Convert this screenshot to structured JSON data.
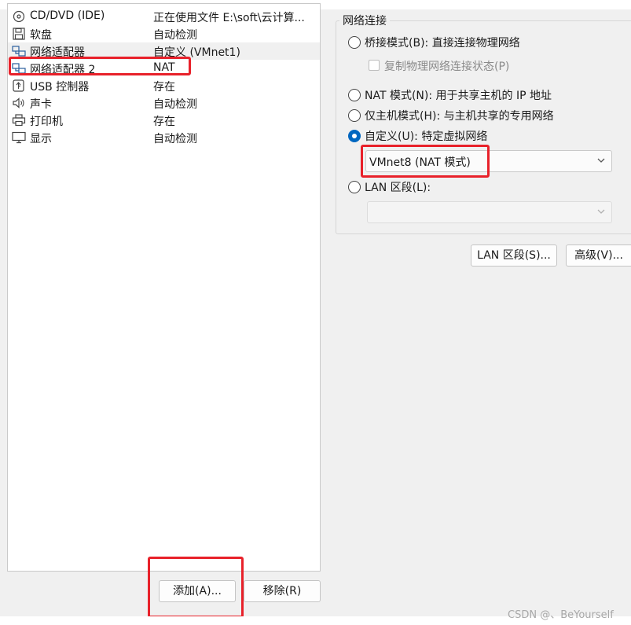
{
  "devices": [
    {
      "name": "CD/DVD (IDE)",
      "summary": "正在使用文件 E:\\soft\\云计算...",
      "icon": "cd-icon"
    },
    {
      "name": "软盘",
      "summary": "自动检测",
      "icon": "floppy-icon"
    },
    {
      "name": "网络适配器",
      "summary": "自定义 (VMnet1)",
      "icon": "network-adapter-icon"
    },
    {
      "name": "网络适配器 2",
      "summary": "NAT",
      "icon": "network-adapter-icon"
    },
    {
      "name": "USB 控制器",
      "summary": "存在",
      "icon": "usb-icon"
    },
    {
      "name": "声卡",
      "summary": "自动检测",
      "icon": "speaker-icon"
    },
    {
      "name": "打印机",
      "summary": "存在",
      "icon": "printer-icon"
    },
    {
      "name": "显示",
      "summary": "自动检测",
      "icon": "monitor-icon"
    }
  ],
  "buttons": {
    "add": "添加(A)...",
    "remove": "移除(R)",
    "lan_segments": "LAN 区段(S)...",
    "advanced": "高级(V)..."
  },
  "network": {
    "group_title": "网络连接",
    "bridged": "桥接模式(B): 直接连接物理网络",
    "replicate": "复制物理网络连接状态(P)",
    "nat": "NAT 模式(N): 用于共享主机的 IP 地址",
    "host_only": "仅主机模式(H): 与主机共享的专用网络",
    "custom": "自定义(U): 特定虚拟网络",
    "custom_value": "VMnet8 (NAT 模式)",
    "lan_segment": "LAN 区段(L):",
    "lan_segment_value": "",
    "selected": "custom"
  },
  "watermark": "CSDN @、BeYourself",
  "colors": {
    "accent": "#0067c0",
    "highlight": "#e8212a"
  }
}
